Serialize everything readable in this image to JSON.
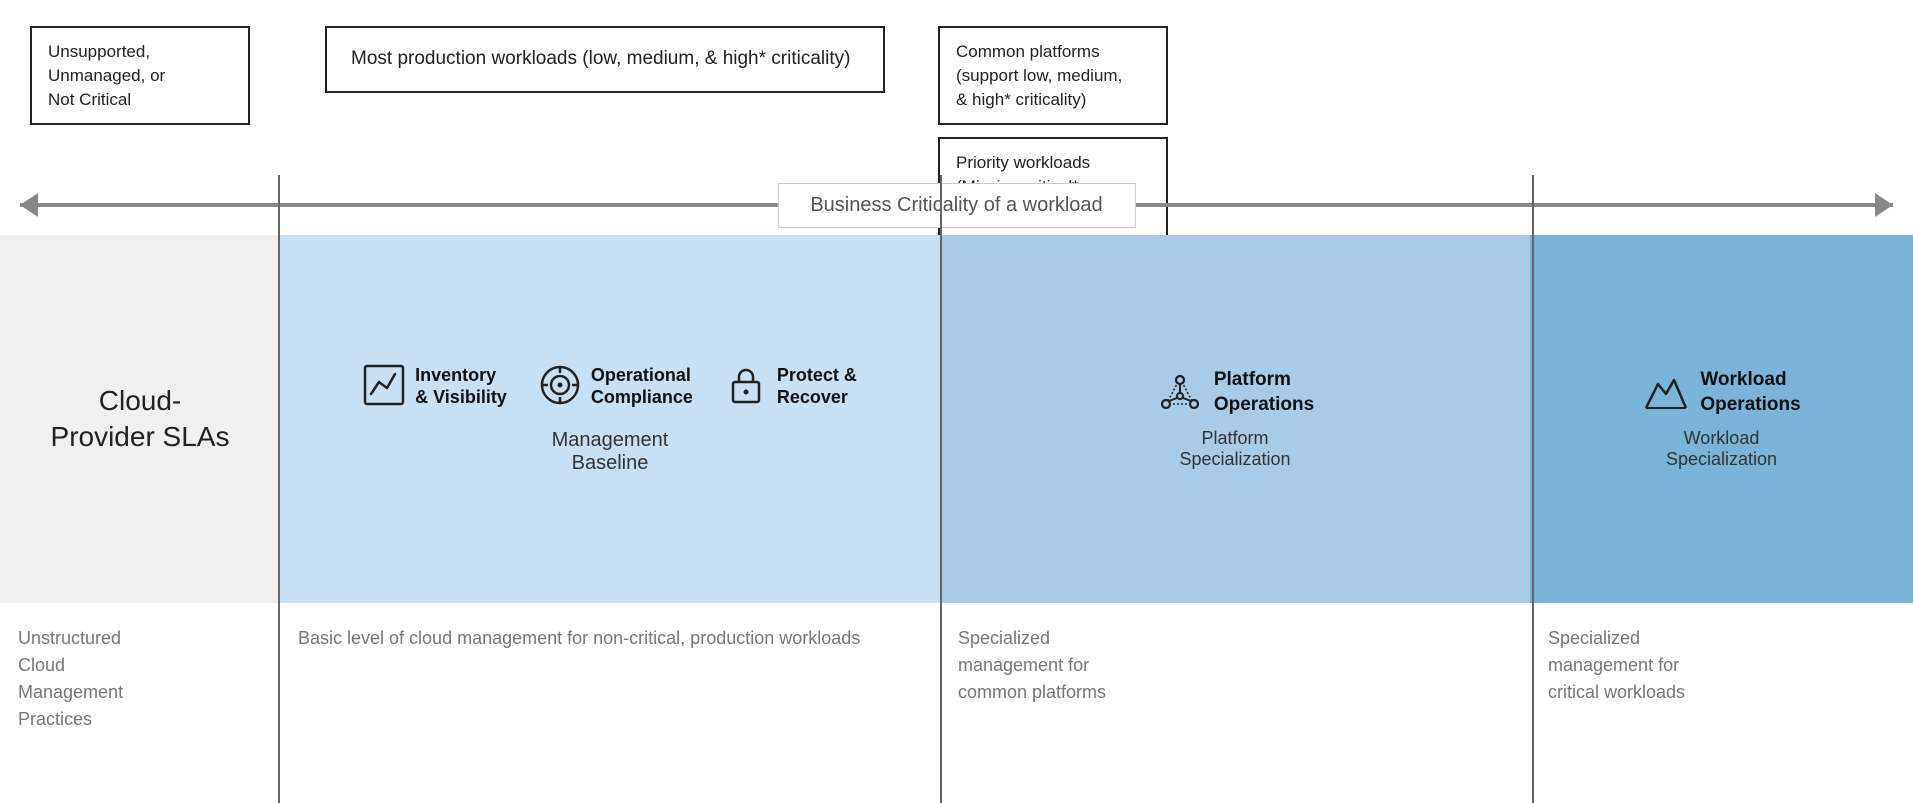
{
  "top": {
    "box1": "Unsupported,\nUnmanaged, or\nNot Critical",
    "box2": "Most production workloads (low, medium, & high* criticality)",
    "box3a": "Common platforms\n(support low, medium,\n& high* criticality)",
    "box3b": "Priority workloads\n(Mission critical* or\nbusiness justification)"
  },
  "arrow": {
    "label": "Business Criticality of a workload"
  },
  "main": {
    "cell1_title": "Cloud-\nProvider SLAs",
    "cell2_icons": [
      {
        "id": "inventory",
        "label": "Inventory\n& Visibility"
      },
      {
        "id": "operational",
        "label": "Operational\nCompliance"
      },
      {
        "id": "protect",
        "label": "Protect &\nRecover"
      }
    ],
    "cell2_subtitle": "Management\nBaseline",
    "cell3_icon_label": "Platform\nOperations",
    "cell3_subtitle": "Platform\nSpecialization",
    "cell4_icon_label": "Workload\nOperations",
    "cell4_subtitle": "Workload\nSpecialization"
  },
  "bottom": {
    "cell1_text": "Unstructured\nCloud\nManagement\nPractices",
    "cell2_text": "Basic level of cloud management for non-critical, production workloads",
    "cell3_text": "Specialized\nmanagement for\ncommon platforms",
    "cell4_text": "Specialized\nmanagement for\ncritical workloads"
  }
}
